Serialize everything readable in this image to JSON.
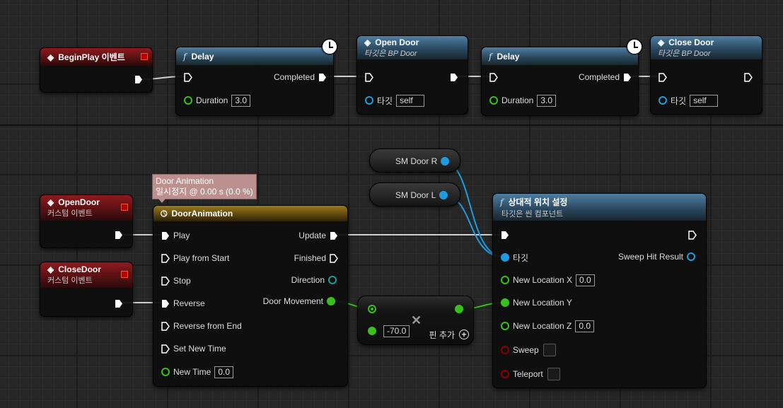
{
  "graph_top": {
    "begin_play": {
      "title": "BeginPlay 이벤트"
    },
    "delay1": {
      "title": "Delay",
      "completed": "Completed",
      "duration_label": "Duration",
      "duration_value": "3.0"
    },
    "open_door": {
      "title": "Open Door",
      "subtitle": "타깃은 BP Door",
      "target_label": "타깃",
      "target_value": "self"
    },
    "delay2": {
      "title": "Delay",
      "completed": "Completed",
      "duration_label": "Duration",
      "duration_value": "3.0"
    },
    "close_door": {
      "title": "Close Door",
      "subtitle": "타깃은 BP Door",
      "target_label": "타깃",
      "target_value": "self"
    }
  },
  "graph_bottom": {
    "open_door_event": {
      "title": "OpenDoor",
      "subtitle": "커스텀 이벤트"
    },
    "close_door_event": {
      "title": "CloseDoor",
      "subtitle": "커스텀 이벤트"
    },
    "tooltip": {
      "line1": "Door Animation",
      "line2": "일시정지 @ 0.00 s (0.0 %)"
    },
    "timeline": {
      "title": "DoorAnimation",
      "inputs": [
        "Play",
        "Play from Start",
        "Stop",
        "Reverse",
        "Reverse from End",
        "Set New Time"
      ],
      "new_time_label": "New Time",
      "new_time_value": "0.0",
      "outputs": [
        "Update",
        "Finished",
        "Direction",
        "Door Movement"
      ]
    },
    "multiply": {
      "value": "-70.0",
      "add_pin": "핀 추가"
    },
    "sm_door_r": "SM Door R",
    "sm_door_l": "SM Door L",
    "set_location": {
      "title": "상대적 위치 설정",
      "subtitle": "타깃은 씬 컴포넌트",
      "target_label": "타깃",
      "sweep_hit_result": "Sweep Hit Result",
      "loc_x_label": "New Location X",
      "loc_x_value": "0.0",
      "loc_y_label": "New Location Y",
      "loc_z_label": "New Location Z",
      "loc_z_value": "0.0",
      "sweep_label": "Sweep",
      "teleport_label": "Teleport"
    }
  },
  "colors": {
    "exec": "#ffffff",
    "float": "#38c11c",
    "object": "#1f9be0",
    "bool": "#8b0000",
    "event_header": "#8e1a1e",
    "function_header": "#4f7ea3",
    "timeline_header": "#9a7a1a"
  }
}
